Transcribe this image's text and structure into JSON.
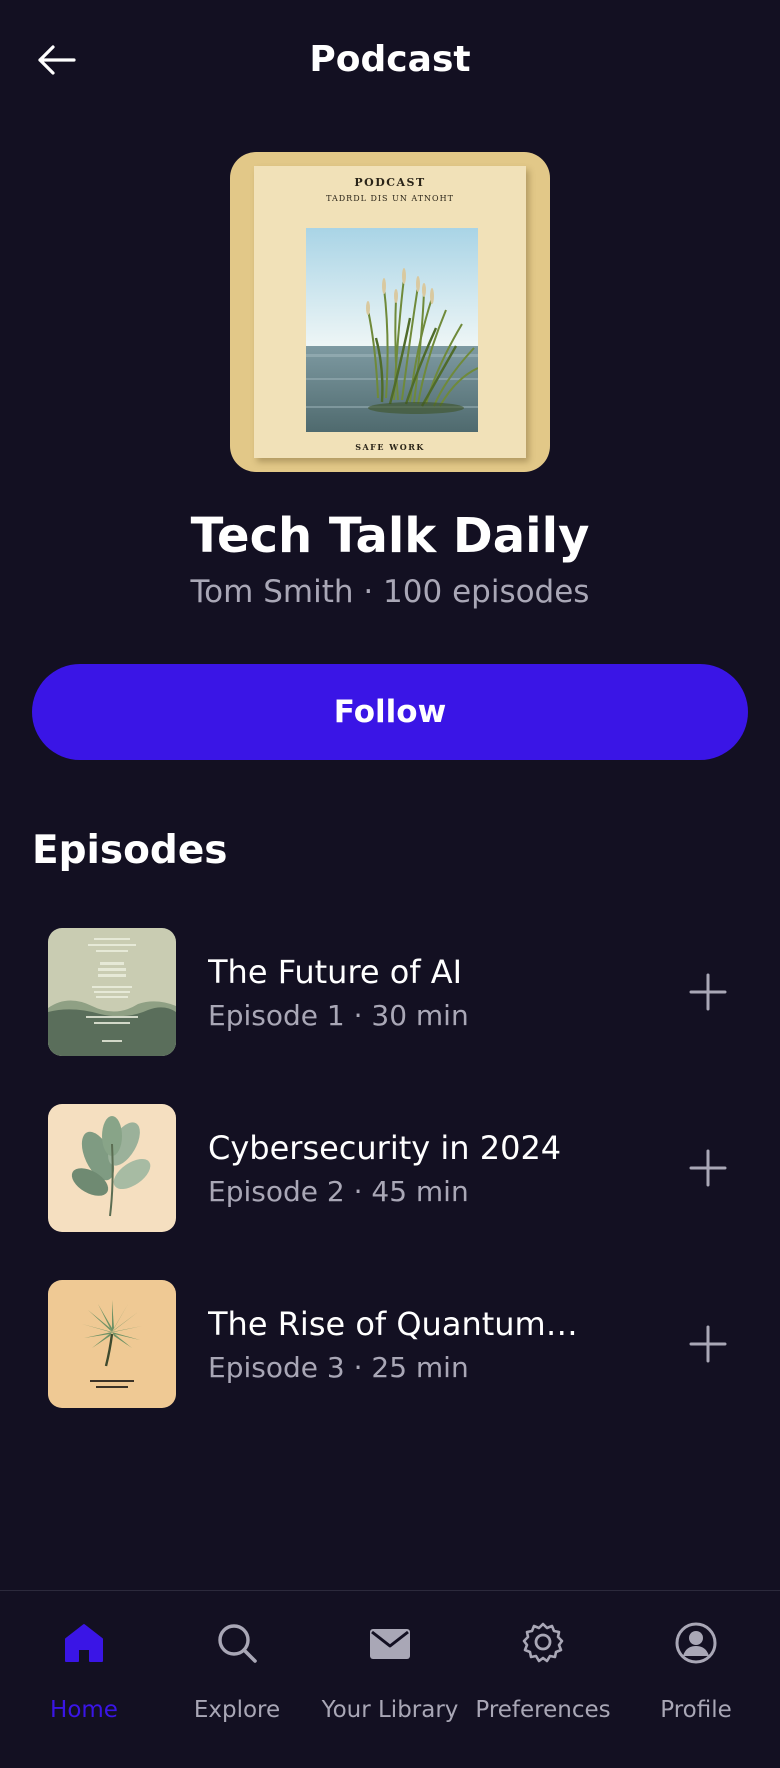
{
  "header": {
    "title": "Podcast",
    "back_icon": "arrow-left-icon"
  },
  "cover": {
    "top_label": "PODCAST",
    "sub_label": "TADRDL DIS UN ATNOHT",
    "bottom_label": "SAFE WORK",
    "background": "#e2c888"
  },
  "show": {
    "title": "Tech Talk Daily",
    "meta": "Tom Smith · 100 episodes"
  },
  "follow": {
    "label": "Follow",
    "color": "#3a15e6"
  },
  "episodes_section": {
    "title": "Episodes",
    "items": [
      {
        "title": "The Future of AI",
        "meta": "Episode 1 · 30 min",
        "add_icon": "plus-icon"
      },
      {
        "title": "Cybersecurity in 2024",
        "meta": "Episode 2 · 45 min",
        "add_icon": "plus-icon"
      },
      {
        "title": "The Rise of Quantum…",
        "meta": "Episode 3 · 25 min",
        "add_icon": "plus-icon"
      }
    ]
  },
  "bottom_nav": {
    "active_color": "#3a15e6",
    "items": [
      {
        "label": "Home",
        "icon": "home-icon",
        "active": true
      },
      {
        "label": "Explore",
        "icon": "search-icon",
        "active": false
      },
      {
        "label": "Your Library",
        "icon": "mail-icon",
        "active": false
      },
      {
        "label": "Preferences",
        "icon": "gear-icon",
        "active": false
      },
      {
        "label": "Profile",
        "icon": "user-circle-icon",
        "active": false
      }
    ]
  }
}
